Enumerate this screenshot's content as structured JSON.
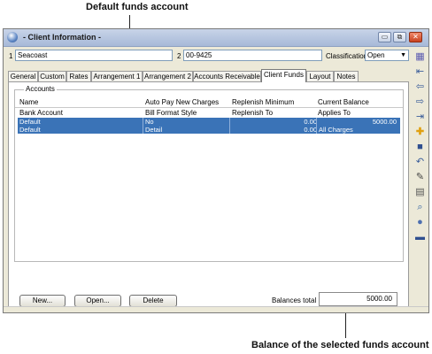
{
  "callouts": {
    "top": "Default funds account",
    "bottom": "Balance of the selected funds account"
  },
  "window": {
    "title": "- Client Information -",
    "controls": {
      "minimize": "▭",
      "restore": "⧉",
      "close": "✕"
    }
  },
  "client": {
    "number_label": "1",
    "name": "Seacoast",
    "code_label": "2",
    "code": "00-9425",
    "classification_label": "Classification",
    "classification_value": "Open"
  },
  "tabs": [
    {
      "label": "General"
    },
    {
      "label": "Custom"
    },
    {
      "label": "Rates"
    },
    {
      "label": "Arrangement 1"
    },
    {
      "label": "Arrangement 2"
    },
    {
      "label": "Accounts Receivable"
    },
    {
      "label": "Client Funds",
      "active": true
    },
    {
      "label": "Layout"
    },
    {
      "label": "Notes"
    }
  ],
  "accounts": {
    "group_label": "Accounts",
    "headers_row1": [
      "Name",
      "Auto Pay New Charges",
      "Replenish Minimum",
      "Current Balance"
    ],
    "headers_row2": [
      "Bank Account",
      "Bill Format Style",
      "Replenish To",
      "Applies To"
    ],
    "rows": [
      {
        "name": "Default",
        "auto_pay": "No",
        "replenish_min": "0.00",
        "current_balance": "5000.00"
      },
      {
        "name": "Default",
        "auto_pay": "Detail",
        "replenish_min": "0.00",
        "current_balance": "All Charges"
      }
    ]
  },
  "buttons": {
    "new": "New...",
    "open": "Open...",
    "delete": "Delete"
  },
  "balances": {
    "label": "Balances total",
    "value": "5000.00"
  },
  "toolbar_icons": [
    "grid-icon",
    "import-icon",
    "back-icon",
    "forward-icon",
    "export-icon",
    "add-icon",
    "save-icon",
    "undo-icon",
    "edit-doc-icon",
    "doc-icon",
    "search-icon",
    "database-icon",
    "divider-icon"
  ],
  "colors": {
    "selection": "#3a73b7",
    "window_bg": "#ece9d8",
    "title_bar": "#b7c6e0"
  }
}
